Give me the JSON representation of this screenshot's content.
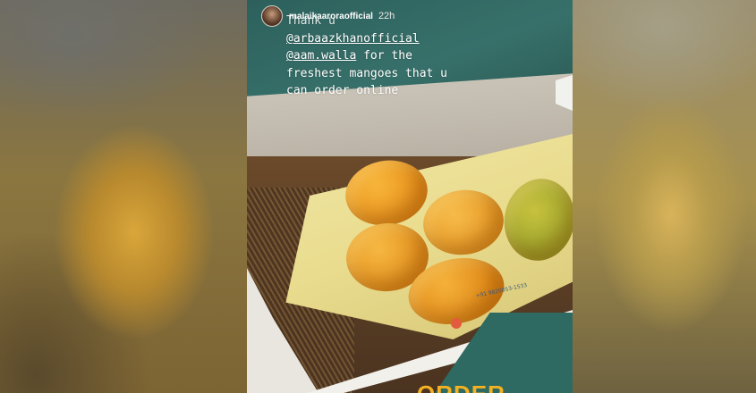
{
  "story": {
    "username": "malaikaaroraofficial",
    "time_ago": "22h",
    "caption": {
      "line1": "Thank u",
      "mention1": "@arbaazkhanofficial",
      "mention2": "@aam.walla",
      "line3_rest": " for the",
      "line4": "freshest mangoes that u",
      "line5": "can order online"
    },
    "box_print": "+91 9820053-1533",
    "bottom_sticker_text": "ORDER"
  },
  "colors": {
    "teal_background": "#2f5b56",
    "paper_yellow": "#e9dc8e",
    "mango_orange": "#e8901a",
    "mango_green": "#97a12a",
    "sticker_yellow": "#f2b022"
  }
}
